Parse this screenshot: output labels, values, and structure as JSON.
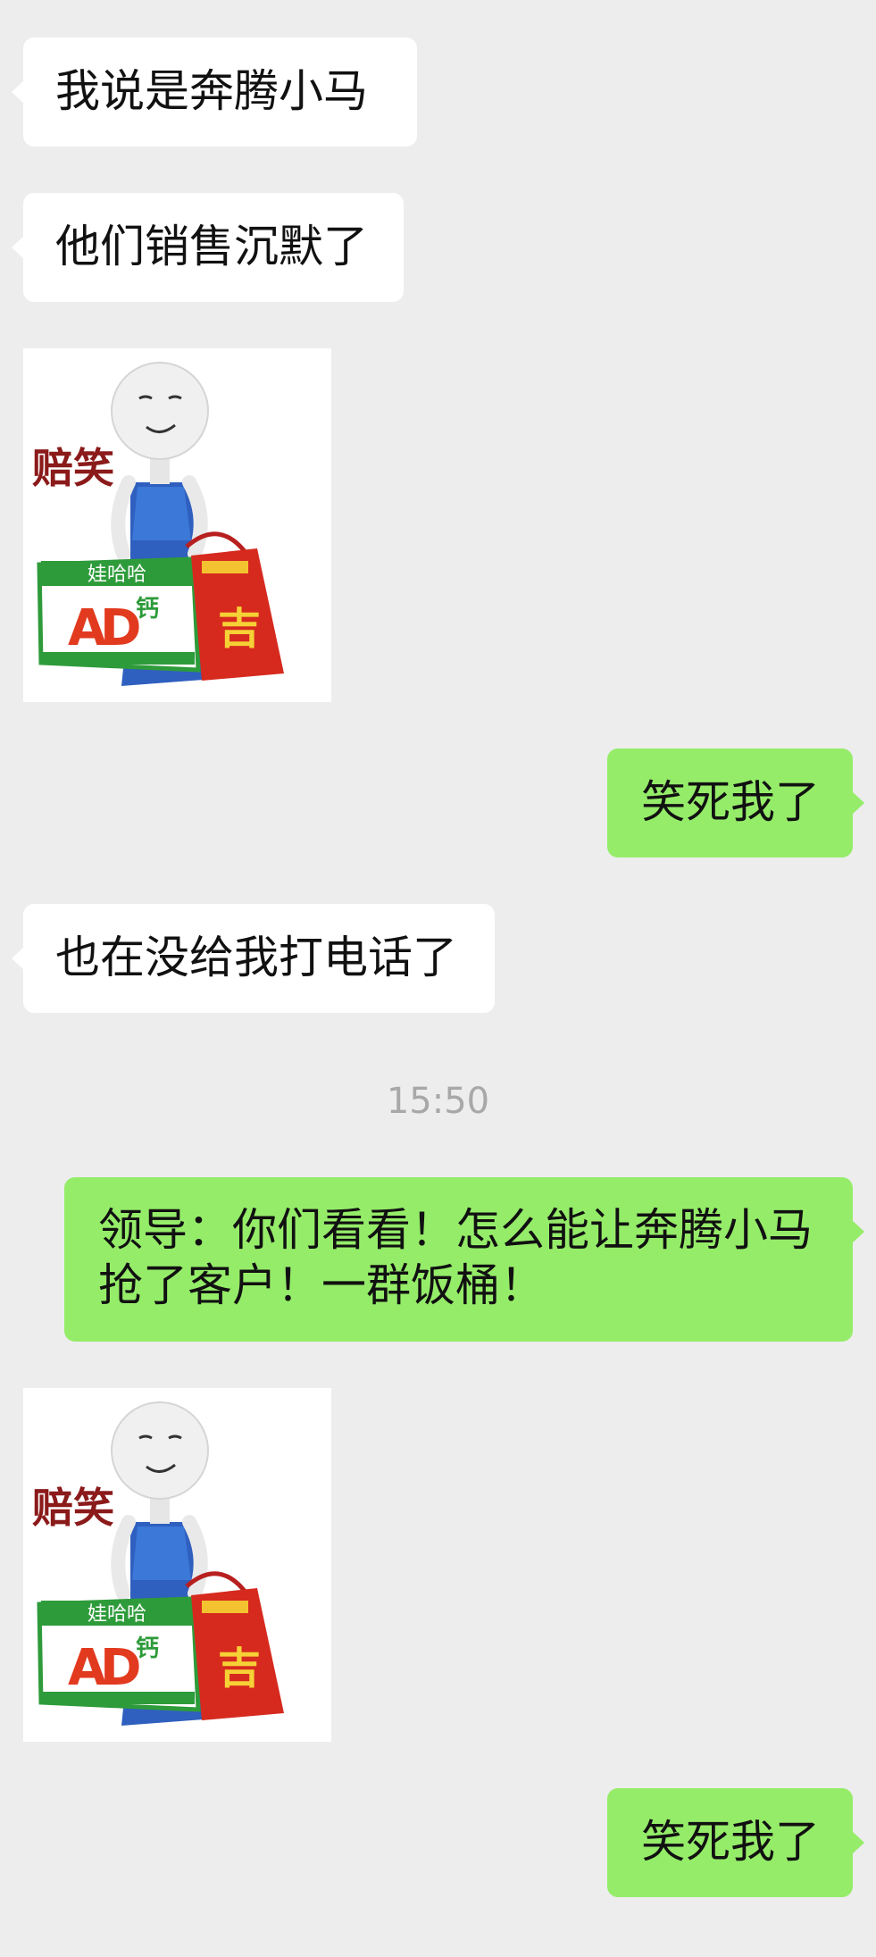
{
  "messages": [
    {
      "side": "left",
      "text": "我说是奔腾小马"
    },
    {
      "side": "left",
      "text": "他们销售沉默了"
    },
    {
      "side": "left",
      "type": "sticker",
      "caption": "赔笑",
      "brand": "娃哈哈",
      "product": "AD钙",
      "bag_char": "吉"
    },
    {
      "side": "right",
      "text": "笑死我了"
    },
    {
      "side": "left",
      "text": "也在没给我打电话了"
    },
    {
      "side": "right",
      "lines": [
        "领导：你们看看！怎么能让奔腾小马",
        "抢了客户！一群饭桶！"
      ]
    },
    {
      "side": "left",
      "type": "sticker",
      "caption": "赔笑",
      "brand": "娃哈哈",
      "product": "AD钙",
      "bag_char": "吉"
    },
    {
      "side": "right",
      "text": "笑死我了"
    }
  ],
  "timestamp": "15:50",
  "colors": {
    "background": "#ededed",
    "incoming_bubble": "#ffffff",
    "outgoing_bubble": "#95ec69"
  }
}
